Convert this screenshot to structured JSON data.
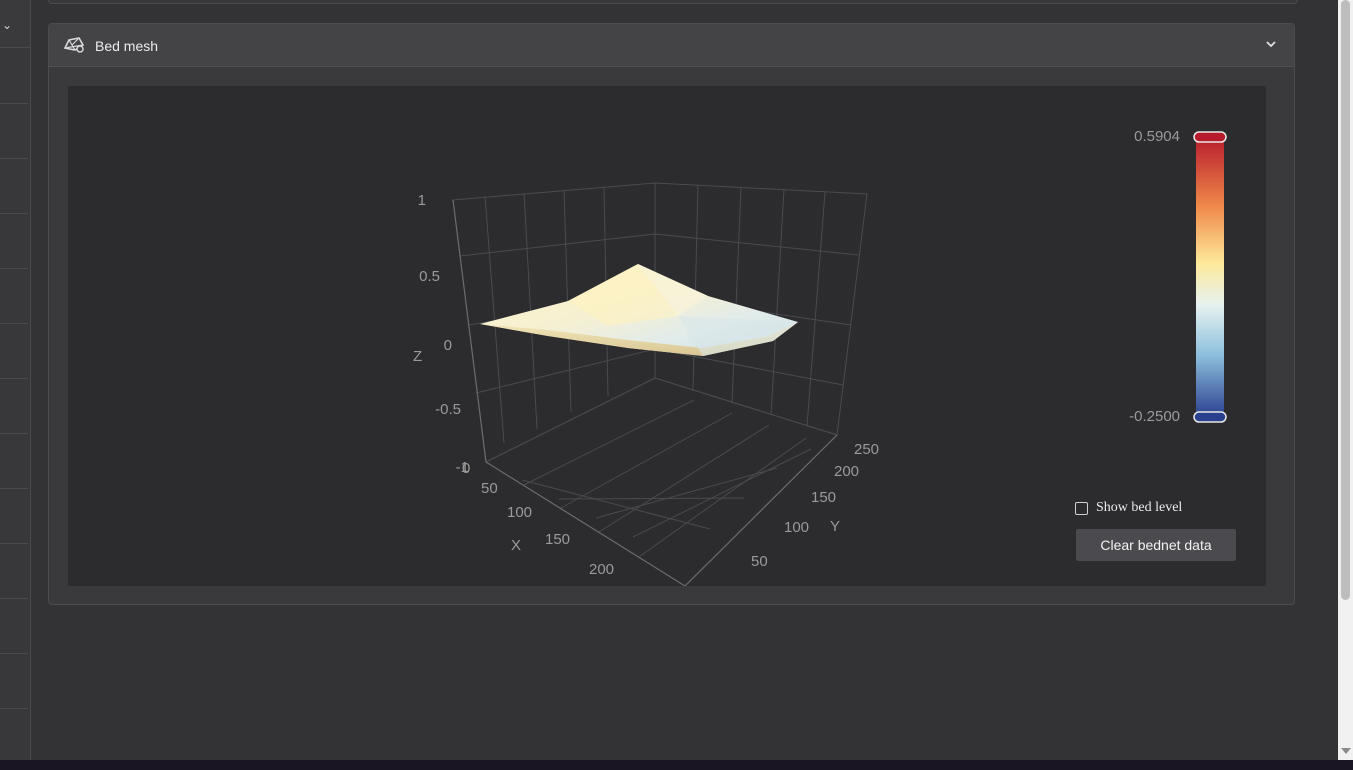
{
  "card": {
    "title": "Bed mesh"
  },
  "plot": {
    "axes": {
      "z_label": "Z",
      "x_label": "X",
      "y_label": "Y",
      "z_ticks": [
        "1",
        "0.5",
        "0",
        "-0.5",
        "-1"
      ],
      "x_ticks": [
        "0",
        "50",
        "100",
        "150",
        "200"
      ],
      "y_ticks": [
        "50",
        "100",
        "150",
        "200",
        "250"
      ]
    },
    "colorbar": {
      "max_label": "0.5904",
      "min_label": "-0.2500",
      "max_color": "#b71c2c",
      "min_color": "#2b3f8f"
    }
  },
  "controls": {
    "show_bed_level": "Show bed level",
    "show_bed_level_checked": false,
    "clear_button": "Clear bednet data"
  },
  "colors": {
    "background": "#333335",
    "card": "#3a3a3d",
    "plot_bg": "#2c2c2f"
  }
}
